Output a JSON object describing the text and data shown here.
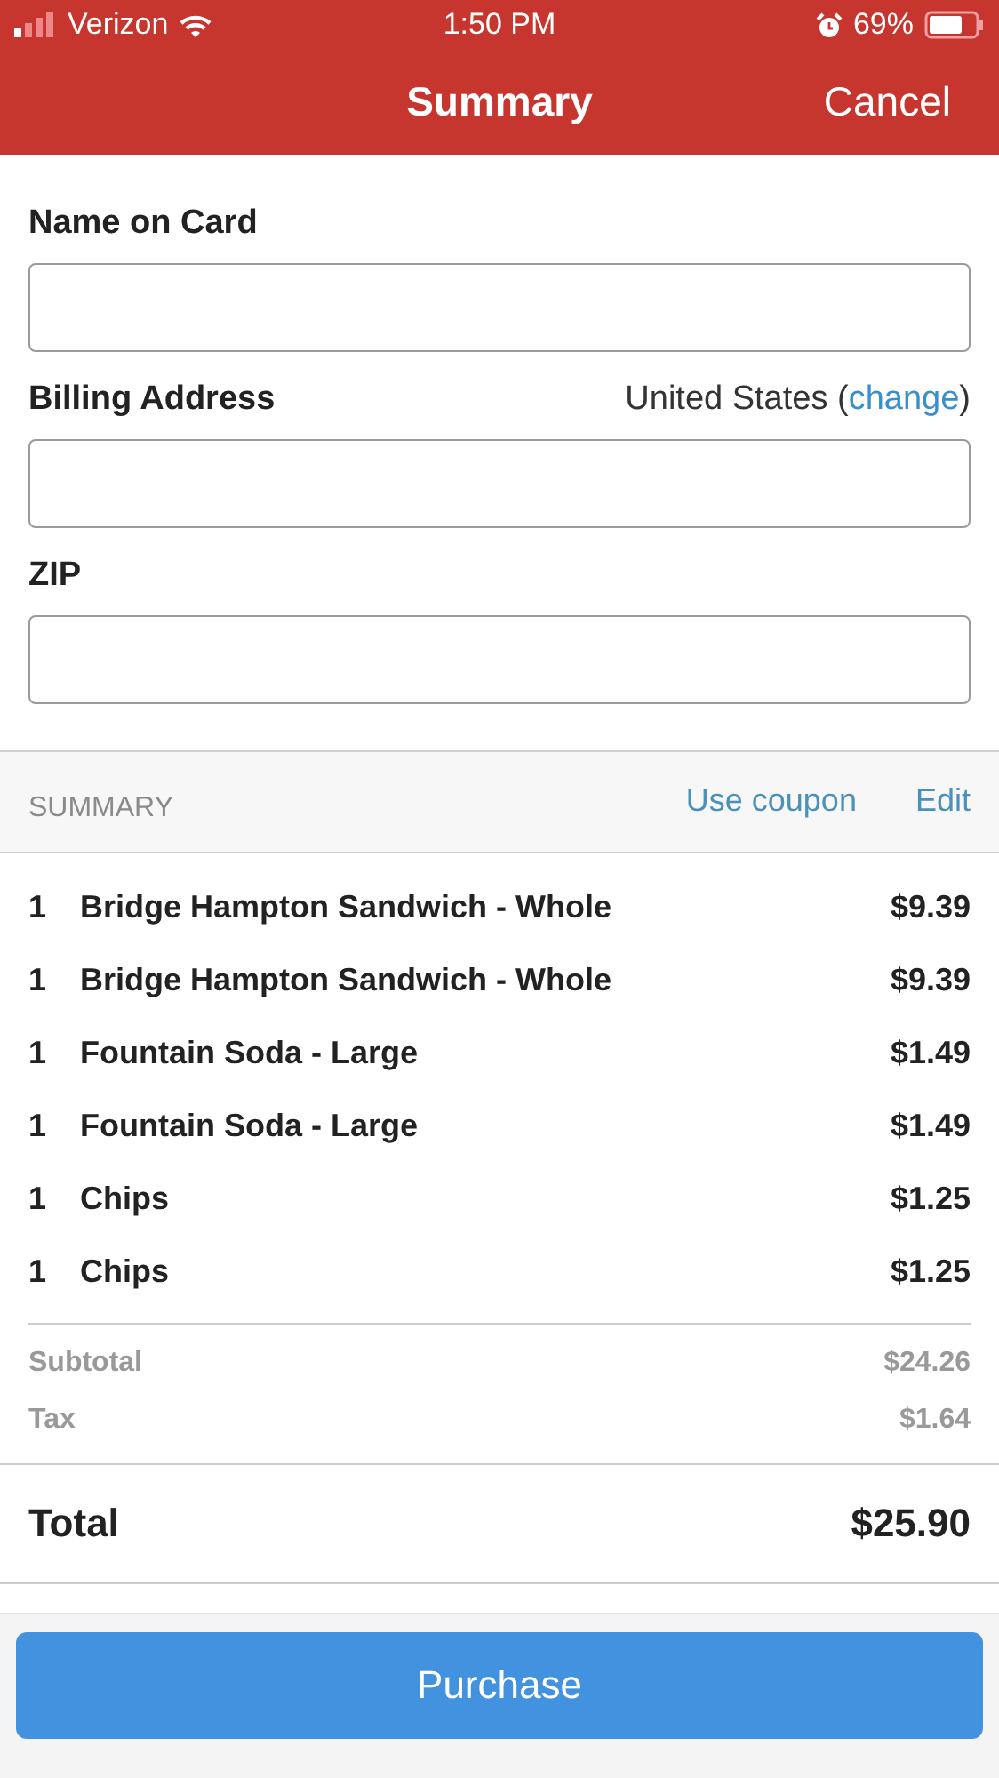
{
  "status_bar": {
    "carrier": "Verizon",
    "time": "1:50 PM",
    "battery": "69%"
  },
  "nav": {
    "title": "Summary",
    "cancel": "Cancel"
  },
  "form": {
    "fields": [
      {
        "label": "Name on Card"
      },
      {
        "label": "Billing Address",
        "country_prefix": "United States (",
        "change_link": "change",
        "country_suffix": ")"
      },
      {
        "label": "ZIP"
      }
    ]
  },
  "summary": {
    "heading": "SUMMARY",
    "coupon_link": "Use coupon",
    "edit_link": "Edit",
    "items": [
      {
        "qty": "1",
        "name": "Bridge Hampton Sandwich - Whole",
        "price": "$9.39"
      },
      {
        "qty": "1",
        "name": "Bridge Hampton Sandwich - Whole",
        "price": "$9.39"
      },
      {
        "qty": "1",
        "name": "Fountain Soda - Large",
        "price": "$1.49"
      },
      {
        "qty": "1",
        "name": "Fountain Soda - Large",
        "price": "$1.49"
      },
      {
        "qty": "1",
        "name": "Chips",
        "price": "$1.25"
      },
      {
        "qty": "1",
        "name": "Chips",
        "price": "$1.25"
      }
    ],
    "subtotal_label": "Subtotal",
    "subtotal": "$24.26",
    "tax_label": "Tax",
    "tax": "$1.64",
    "total_label": "Total",
    "total": "$25.90"
  },
  "purchase_button": "Purchase"
}
